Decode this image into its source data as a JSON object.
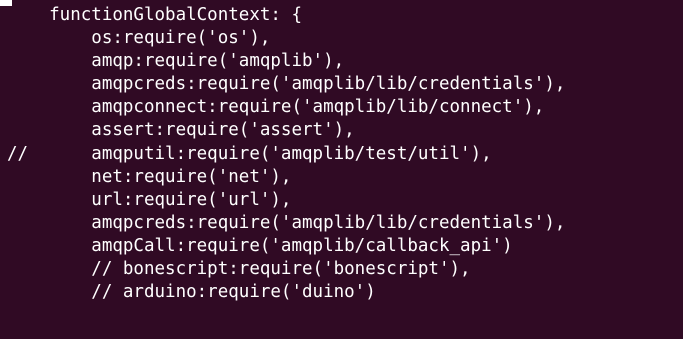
{
  "colors": {
    "terminal_background": "#300a24",
    "text": "#ffffff"
  },
  "code_lines": [
    "    functionGlobalContext: {",
    "        os:require('os'),",
    "        amqp:require('amqplib'),",
    "        amqpcreds:require('amqplib/lib/credentials'),",
    "        amqpconnect:require('amqplib/lib/connect'),",
    "        assert:require('assert'),",
    "//      amqputil:require('amqplib/test/util'),",
    "        net:require('net'),",
    "        url:require('url'),",
    "        amqpcreds:require('amqplib/lib/credentials'),",
    "        amqpCall:require('amqplib/callback_api')",
    "        // bonescript:require('bonescript'),",
    "        // arduino:require('duino')"
  ]
}
